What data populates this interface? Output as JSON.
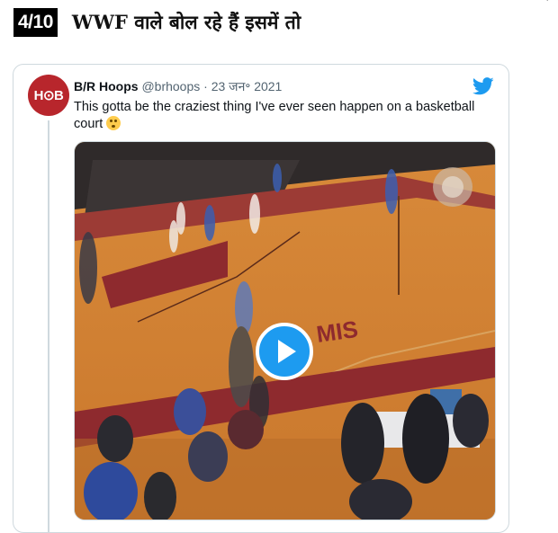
{
  "slide": {
    "counter": "4/10",
    "headline": "WWF वाले बोल रहे हैं इसमें तो"
  },
  "tweet": {
    "avatar_text": "H⊙B",
    "display_name": "B/R Hoops",
    "handle": "@brhoops",
    "separator": "·",
    "date": "23 जन॰ 2021",
    "text": "This gotta be the craziest thing I've ever seen happen on a basketball court",
    "emoji": "flushed-face",
    "brand_icon": "twitter-bird-icon",
    "court_logo_text": "MIS",
    "colors": {
      "twitter_blue": "#1d9bf0",
      "avatar_red": "#b8262c",
      "court_wood": "#c97f34",
      "court_red": "#8e2a2e"
    }
  },
  "video": {
    "control": "play-icon"
  }
}
